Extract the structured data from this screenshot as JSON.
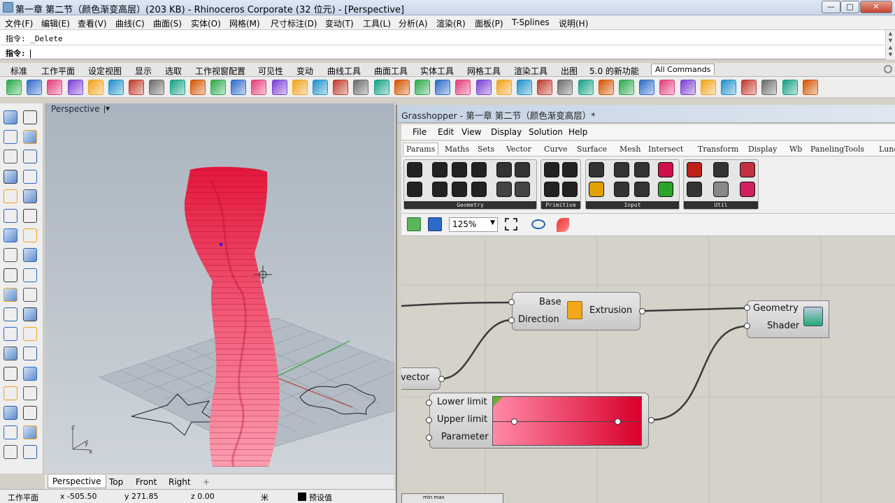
{
  "window": {
    "title": "第一章 第二节（颜色渐变高层）(203 KB) - Rhinoceros Corporate (32 位元) - [Perspective]",
    "min_label": "—",
    "max_label": "□",
    "close_label": "✕"
  },
  "menubar": [
    "文件(F)",
    "编辑(E)",
    "查看(V)",
    "曲线(C)",
    "曲面(S)",
    "实体(O)",
    "网格(M)",
    "尺寸标注(D)",
    "变动(T)",
    "工具(L)",
    "分析(A)",
    "渲染(R)",
    "面板(P)",
    "T-Splines",
    "说明(H)"
  ],
  "command": {
    "history_label": "指令:",
    "history_value": "_Delete",
    "prompt_label": "指令:"
  },
  "toolbar_tabs": [
    "标准",
    "工作平面",
    "设定视图",
    "显示",
    "选取",
    "工作视窗配置",
    "可见性",
    "变动",
    "曲线工具",
    "曲面工具",
    "实体工具",
    "网格工具",
    "渲染工具",
    "出图",
    "5.0 的新功能",
    "All Commands"
  ],
  "toolbar_icons": [
    "power-icon",
    "cube-icon",
    "sphere-icon",
    "curve-icon",
    "grid-icon",
    "box-icon",
    "arc-icon",
    "pen-icon",
    "select-icon",
    "wave-icon",
    "magnet-icon",
    "rotate-icon",
    "ribbon-icon",
    "frame-icon",
    "box2-icon",
    "curl-icon",
    "truss-icon",
    "lattice-icon",
    "mesh-icon",
    "patch-icon",
    "warp-icon",
    "flow-icon",
    "twist-icon",
    "tape-icon",
    "knit-icon",
    "bend-icon",
    "taper-icon",
    "crossing-icon",
    "rail-icon",
    "cage-icon",
    "loft-icon",
    "dome-icon",
    "spiral-icon",
    "wire-icon",
    "net-icon",
    "torus-icon",
    "flag-icon",
    "split-icon",
    "cap-icon",
    "gear-icon"
  ],
  "viewport": {
    "name": "Perspective",
    "axis_x": "x",
    "axis_y": "y",
    "axis_z": "z"
  },
  "view_tabs": [
    "Perspective",
    "Top",
    "Front",
    "Right"
  ],
  "view_tab_add": "+",
  "status": {
    "cplane": "工作平面",
    "x": "x -505.50",
    "y": "y 271.85",
    "z": "z 0.00",
    "unit": "米",
    "layer": "预设值"
  },
  "grasshopper": {
    "title": "Grasshopper - 第一章 第二节（颜色渐变高层）*",
    "menu": [
      "File",
      "Edit",
      "View",
      "Display",
      "Solution",
      "Help"
    ],
    "tabs": [
      "Params",
      "Maths",
      "Sets",
      "Vector",
      "Curve",
      "Surface",
      "Mesh",
      "Intersect",
      "Transform",
      "Display",
      "Wb",
      "PanelingTools",
      "Lunc"
    ],
    "panels": [
      {
        "label": "Geometry"
      },
      {
        "label": "Primitive"
      },
      {
        "label": "Input"
      },
      {
        "label": "Util"
      }
    ],
    "zoom": "125%",
    "extrude": {
      "in1": "Base",
      "in2": "Direction",
      "out": "Extrusion"
    },
    "preview": {
      "in1": "Geometry",
      "in2": "Shader"
    },
    "vector": {
      "label": "vector"
    },
    "gradient": {
      "in1": "Lower limit",
      "in2": "Upper limit",
      "in3": "Parameter",
      "color_low": "#ff8aa6",
      "color_high": "#d8002c"
    },
    "bottom_label": "min max"
  }
}
